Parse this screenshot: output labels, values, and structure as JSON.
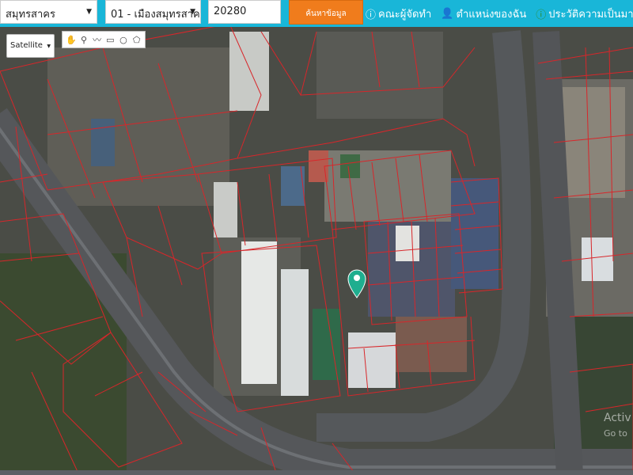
{
  "topbar": {
    "province": "สมุทรสาคร",
    "district": "01 - เมืองสมุทรสาค",
    "zipcode": "20280",
    "search_button": "ค้นหาข้อมูล",
    "links": [
      {
        "label": "คณะผู้จัดทำ",
        "icon": "info-icon"
      },
      {
        "label": "ตำแหน่งของฉัน",
        "icon": "person-icon"
      },
      {
        "label": "ประวัติความเป็นมา",
        "icon": "info-icon"
      }
    ]
  },
  "map_controls": {
    "map_type": "Satellite",
    "draw_tools": [
      "hand-tool-icon",
      "marker-tool-icon",
      "polyline-tool-icon",
      "rectangle-tool-icon",
      "circle-tool-icon",
      "polygon-tool-icon"
    ]
  },
  "watermark": {
    "line1": "Activ",
    "line2": "Go to"
  },
  "colors": {
    "topbar": "#19b6d8",
    "search_button": "#f07c1c",
    "parcel_lines": "#d8262a",
    "marker": "#1fae8f"
  }
}
